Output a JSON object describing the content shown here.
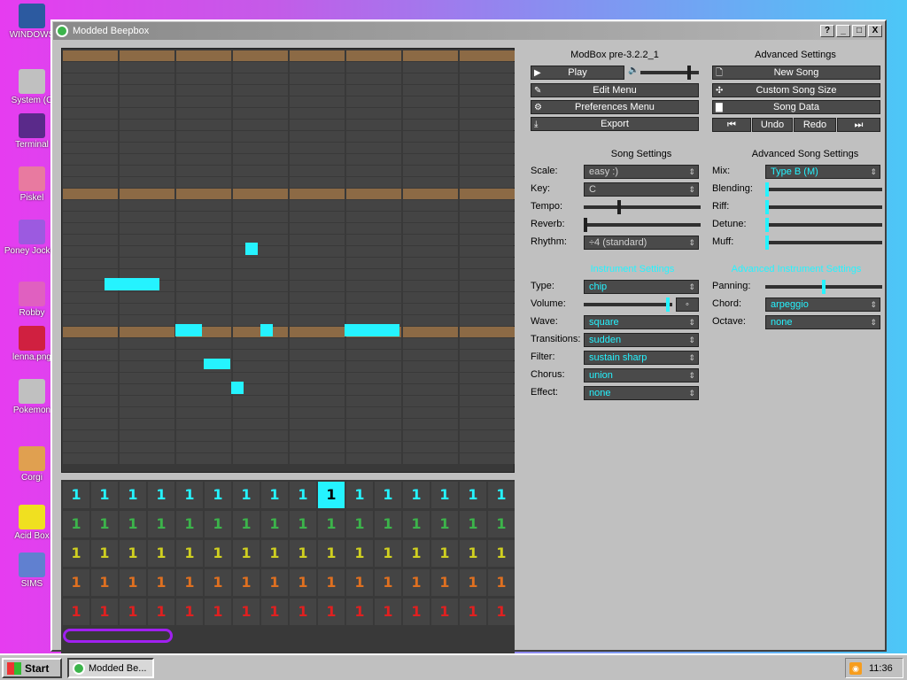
{
  "desktop": {
    "icons": [
      {
        "label": "WINDOWS",
        "color": "#2c5aa0"
      },
      {
        "label": "System (C",
        "color": "#c0c0c0"
      },
      {
        "label": "Terminal",
        "color": "#5a2a8a"
      },
      {
        "label": "Piskel",
        "color": "#e87aa0"
      },
      {
        "label": "Poney Jockey",
        "color": "#9c5ae0"
      },
      {
        "label": "Robby",
        "color": "#e060c0"
      },
      {
        "label": "lenna.png",
        "color": "#d02040"
      },
      {
        "label": "Pokemon",
        "color": "#c0c0c0"
      },
      {
        "label": "Corgi",
        "color": "#e0a050"
      },
      {
        "label": "Acid Box",
        "color": "#f0e020"
      },
      {
        "label": "SIMS",
        "color": "#6080d0"
      }
    ]
  },
  "window": {
    "title": "Modded Beepbox",
    "help_btn": "?",
    "min_btn": "_",
    "max_btn": "□",
    "close_btn": "X"
  },
  "panel": {
    "version": "ModBox pre-3.2.2_1",
    "advanced_title": "Advanced Settings",
    "play": "Play",
    "edit_menu": "Edit Menu",
    "preferences_menu": "Preferences Menu",
    "export": "Export",
    "new_song": "New Song",
    "custom_song_size": "Custom Song Size",
    "song_data": "Song Data",
    "undo": "Undo",
    "redo": "Redo",
    "volume_level": 0.85
  },
  "song_settings": {
    "title": "Song Settings",
    "scale_label": "Scale:",
    "scale_value": "easy :)",
    "key_label": "Key:",
    "key_value": "C",
    "tempo_label": "Tempo:",
    "tempo_level": 0.3,
    "reverb_label": "Reverb:",
    "reverb_level": 0.0,
    "rhythm_label": "Rhythm:",
    "rhythm_value": "÷4 (standard)"
  },
  "advanced_song": {
    "title": "Advanced Song Settings",
    "mix_label": "Mix:",
    "mix_value": "Type B (M)",
    "blending_label": "Blending:",
    "riff_label": "Riff:",
    "detune_label": "Detune:",
    "muff_label": "Muff:"
  },
  "instrument": {
    "title": "Instrument Settings",
    "type_label": "Type:",
    "type_value": "chip",
    "volume_label": "Volume:",
    "volume_level": 0.97,
    "wave_label": "Wave:",
    "wave_value": "square",
    "transitions_label": "Transitions:",
    "transitions_value": "sudden",
    "filter_label": "Filter:",
    "filter_value": "sustain sharp",
    "chorus_label": "Chorus:",
    "chorus_value": "union",
    "effect_label": "Effect:",
    "effect_value": "none"
  },
  "advanced_instrument": {
    "title": "Advanced Instrument Settings",
    "panning_label": "Panning:",
    "panning_level": 0.5,
    "chord_label": "Chord:",
    "chord_value": "arpeggio",
    "octave_label": "Octave:",
    "octave_value": "none"
  },
  "tracks": {
    "cell_value": "1",
    "columns": 16,
    "selected_column": 9,
    "row_colors": [
      "#25f3ff",
      "#3cb44b",
      "#d0d020",
      "#e07020",
      "#e02020"
    ]
  },
  "taskbar": {
    "start": "Start",
    "task": "Modded Be...",
    "clock": "11:36"
  }
}
